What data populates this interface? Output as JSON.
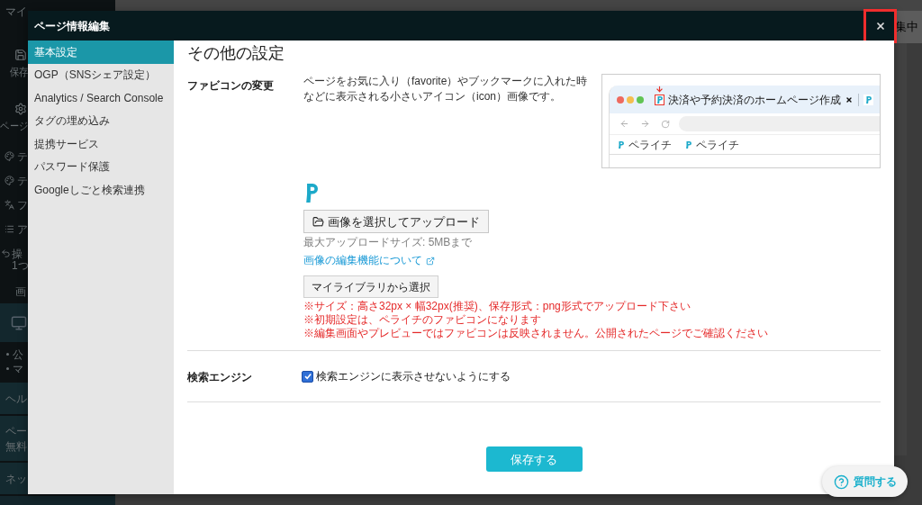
{
  "background": {
    "menu_title": "マイ",
    "status": "集中",
    "tools": [
      {
        "kind": "stacked",
        "label": "保存"
      },
      {
        "kind": "stacked",
        "label": "ページ"
      },
      {
        "kind": "inline",
        "label": "テ"
      },
      {
        "kind": "inline",
        "label": "テ"
      },
      {
        "kind": "inline",
        "label": "フ"
      },
      {
        "kind": "inline",
        "label": "ア"
      }
    ],
    "undo": {
      "label": "操",
      "sub": "1つ"
    },
    "view_label": "画",
    "links": [
      "公",
      "マ"
    ],
    "panels": [
      {
        "lines": [
          "ヘル"
        ]
      },
      {
        "lines": [
          "ペー",
          "無料"
        ]
      },
      {
        "lines": [
          "ネッ"
        ]
      }
    ]
  },
  "modal": {
    "title": "ページ情報編集",
    "close_highlighted": true,
    "nav": [
      {
        "label": "基本設定",
        "selected": true
      },
      {
        "label": "OGP（SNSシェア設定）",
        "selected": false
      },
      {
        "label": "Analytics / Search Console",
        "selected": false
      },
      {
        "label": "タグの埋め込み",
        "selected": false
      },
      {
        "label": "提携サービス",
        "selected": false
      },
      {
        "label": "パスワード保護",
        "selected": false
      },
      {
        "label": "Googleしごと検索連携",
        "selected": false
      }
    ],
    "heading": "その他の設定",
    "favicon": {
      "label": "ファビコンの変更",
      "description": "ページをお気に入り（favorite）やブックマークに入れた時などに表示される小さいアイコン（icon）画像です。",
      "preview": {
        "tab_title": "決済や予約決済のホームページ作成",
        "bookmarks": [
          "ペライチ",
          "ペライチ"
        ]
      },
      "upload_button": "画像を選択してアップロード",
      "max_size": "最大アップロードサイズ: 5MBまで",
      "edit_link": "画像の編集機能について",
      "library_button": "マイライブラリから選択",
      "notes": [
        "※サイズ：高さ32px × 幅32px(推奨)、保存形式：png形式でアップロード下さい",
        "※初期設定は、ペライチのファビコンになります",
        "※編集画面やプレビューではファビコンは反映されません。公開されたページでご確認ください"
      ]
    },
    "search_engine": {
      "label": "検索エンジン",
      "checkbox_label": "検索エンジンに表示させないようにする",
      "checked": true
    },
    "save_button": "保存する"
  },
  "help_button": "質問する"
}
